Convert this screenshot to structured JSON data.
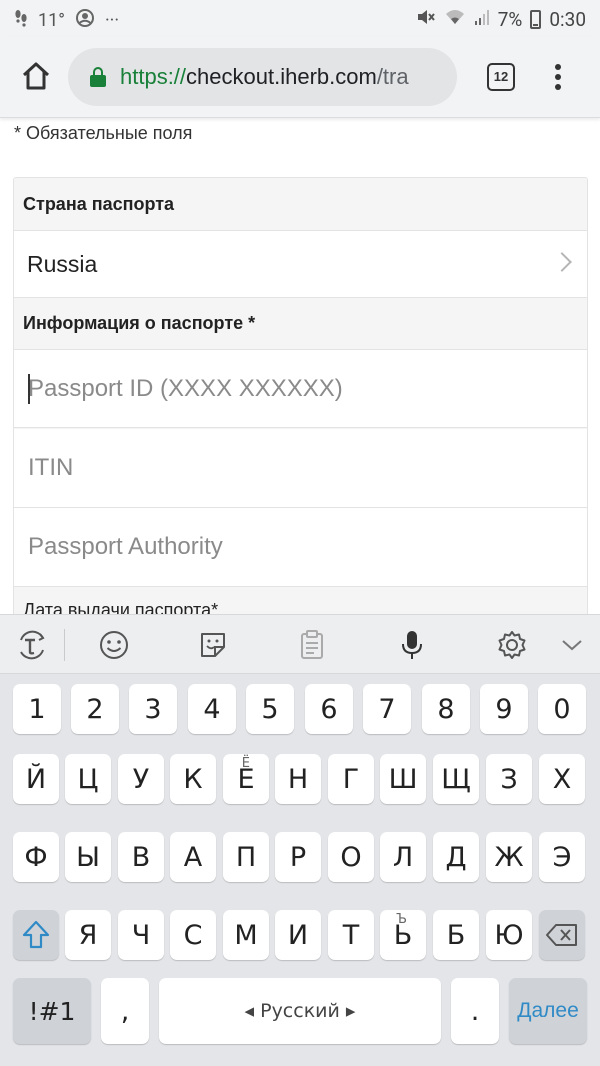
{
  "status_bar": {
    "temperature": "11°",
    "more": "···",
    "battery_percent": "7%",
    "time": "0:30"
  },
  "browser": {
    "url_scheme": "https://",
    "url_host": "checkout.iherb.com",
    "url_path": "/tra",
    "tab_count": "12"
  },
  "form": {
    "required_note": "* Обязательные поля",
    "passport_country_label": "Страна паспорта",
    "passport_country_value": "Russia",
    "passport_info_label": "Информация о паспорте *",
    "passport_id_placeholder": "Passport ID (XXXX XXXXXX)",
    "itin_placeholder": "ITIN",
    "passport_authority_placeholder": "Passport Authority",
    "issue_date_label": "Дата выдачи паспорта*"
  },
  "keyboard": {
    "row_numbers": [
      "1",
      "2",
      "3",
      "4",
      "5",
      "6",
      "7",
      "8",
      "9",
      "0"
    ],
    "row1": [
      "Й",
      "Ц",
      "У",
      "К",
      "Е",
      "Н",
      "Г",
      "Ш",
      "Щ",
      "З",
      "Х"
    ],
    "row1_hint_e": "Ё",
    "row2": [
      "Ф",
      "Ы",
      "В",
      "А",
      "П",
      "Р",
      "О",
      "Л",
      "Д",
      "Ж",
      "Э"
    ],
    "row3": [
      "Я",
      "Ч",
      "С",
      "М",
      "И",
      "Т",
      "Ь",
      "Б",
      "Ю"
    ],
    "row3_hint_soft": "Ъ",
    "symbols_label": "!#1",
    "comma": ",",
    "space_label": "◂ Русский ▸",
    "period": ".",
    "enter_label": "Далее"
  }
}
